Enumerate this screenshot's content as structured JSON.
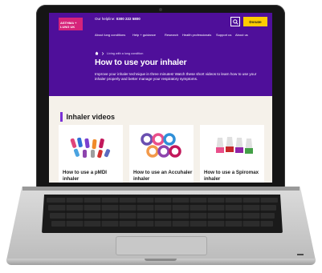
{
  "site": {
    "logo_text": "ASTHMA + LUNG UK",
    "helpline_label": "Our helpline:",
    "helpline_number": "0300 222 5800",
    "donate_label": "Donate",
    "nav": [
      "About lung conditions",
      "Help + guidance",
      "Research",
      "Health professionals",
      "Support us",
      "About us"
    ],
    "breadcrumb": "Living with a lung condition",
    "page_title": "How to use your inhaler",
    "intro": "Improve your inhaler technique in three minutes! Watch these short videos to learn how to use your inhaler properly and better manage your respiratory symptoms."
  },
  "content": {
    "section_title": "Inhaler videos",
    "cards": [
      {
        "label": "How to use a pMDI inhaler"
      },
      {
        "label": "How to use an Accuhaler inhaler"
      },
      {
        "label": "How to use a Spiromax inhaler"
      }
    ]
  },
  "colors": {
    "brand_purple": "#4f0f9a",
    "donate_yellow": "#ffcc00",
    "logo_pink": "#d6237a",
    "accent_bar": "#7a30d6"
  },
  "icons": {
    "search": "search-icon",
    "home": "home-icon",
    "chevron": "chevron-right-icon"
  }
}
